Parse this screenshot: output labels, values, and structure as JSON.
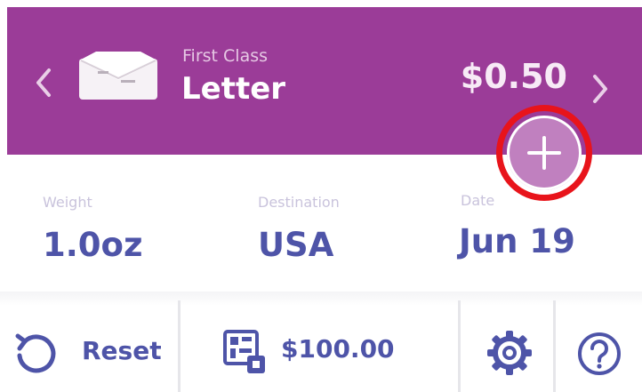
{
  "header": {
    "service_class": "First Class",
    "service_name": "Letter",
    "price": "$0.50"
  },
  "info": {
    "weight_label": "Weight",
    "weight_value": "1.0oz",
    "destination_label": "Destination",
    "destination_value": "USA",
    "date_label": "Date",
    "date_value": "Jun 19"
  },
  "toolbar": {
    "reset_label": "Reset",
    "balance_label": "$100.00"
  },
  "icons": {
    "prev": "chevron-left-icon",
    "next": "chevron-right-icon",
    "envelope": "envelope-icon",
    "add": "plus-icon",
    "reset": "reset-icon",
    "balance": "meter-icon",
    "settings": "gear-icon",
    "help": "help-icon"
  },
  "colors": {
    "header_bg": "#9b3c98",
    "add_button": "#c080bf",
    "highlight_ring": "#e8141b",
    "value_text": "#4e54a8"
  }
}
